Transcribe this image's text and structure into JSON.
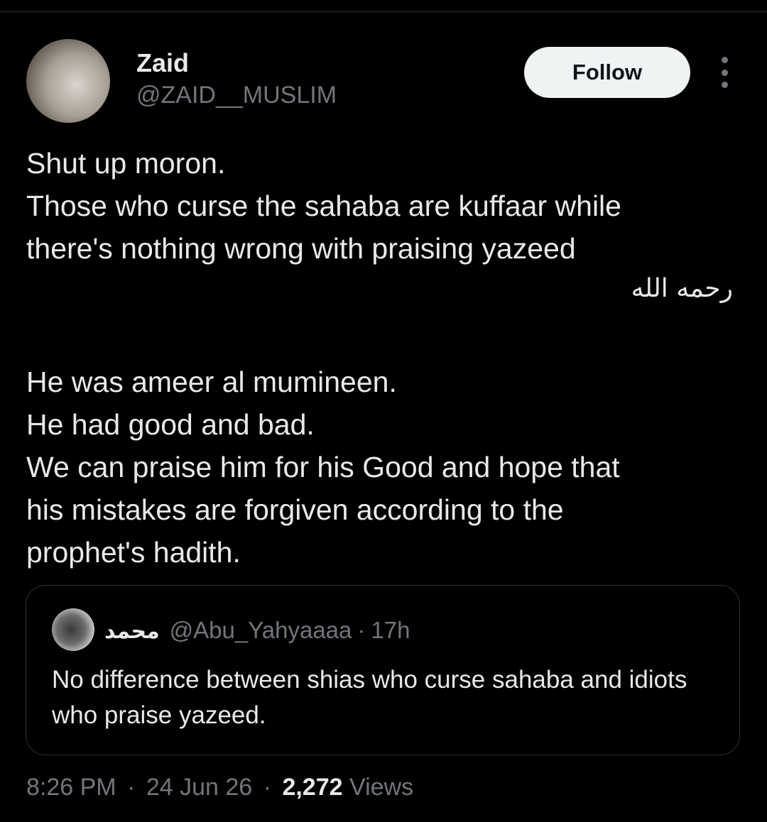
{
  "author": {
    "name": "Zaid",
    "handle": "@ZAID__MUSLIM",
    "avatar_icon": "profile-photo"
  },
  "actions": {
    "follow_label": "Follow",
    "more_icon": "more-options-icon"
  },
  "tweet": {
    "lines_block1": [
      "Shut up moron.",
      "Those who curse the sahaba are kuffaar while",
      "there's nothing wrong with praising yazeed"
    ],
    "arabic": "رحمه الله",
    "lines_block2": [
      "He was ameer al mumineen.",
      "He had good and bad.",
      "We can praise him for his Good and hope that",
      "his mistakes are forgiven according to the",
      "prophet's hadith."
    ]
  },
  "quote": {
    "name": "محمد",
    "handle": "@Abu_Yahyaaaa",
    "separator": "·",
    "time": "17h",
    "text": "No difference between shias who curse sahaba and idiots who praise yazeed."
  },
  "meta": {
    "time": "8:26 PM",
    "separator": "·",
    "date": "24 Jun 26",
    "views_count": "2,272",
    "views_label": "Views"
  },
  "colors": {
    "background": "#000000",
    "text_primary": "#e7e9ea",
    "text_secondary": "#71767b",
    "border": "#2f3336",
    "follow_bg": "#eff3f4"
  }
}
